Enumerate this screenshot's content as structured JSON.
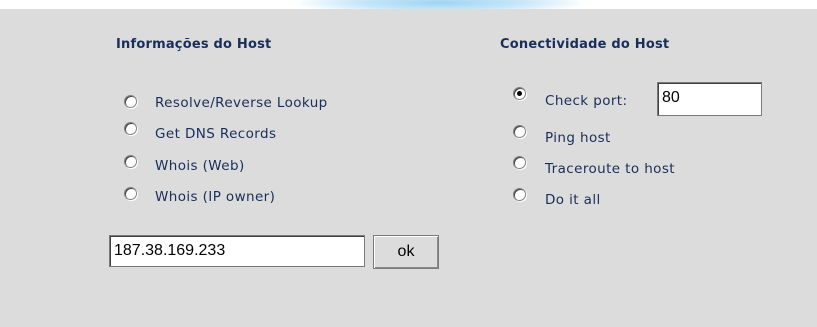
{
  "host_info": {
    "heading": "Informações do Host",
    "options": [
      {
        "label": "Resolve/Reverse Lookup",
        "checked": false
      },
      {
        "label": "Get DNS Records",
        "checked": false
      },
      {
        "label": "Whois (Web)",
        "checked": false
      },
      {
        "label": "Whois (IP owner)",
        "checked": false
      }
    ],
    "ip_input_value": "187.38.169.233",
    "ok_button_label": "ok"
  },
  "host_connectivity": {
    "heading": "Conectividade do Host",
    "options": [
      {
        "label": "Check port:",
        "checked": true
      },
      {
        "label": "Ping host",
        "checked": false
      },
      {
        "label": "Traceroute to host",
        "checked": false
      },
      {
        "label": "Do it all",
        "checked": false
      }
    ],
    "port_input_value": "80"
  },
  "colors": {
    "panel_background": "#dcdcdc",
    "text": "#1a2e5a",
    "top_accent": "#9fd4f2"
  }
}
